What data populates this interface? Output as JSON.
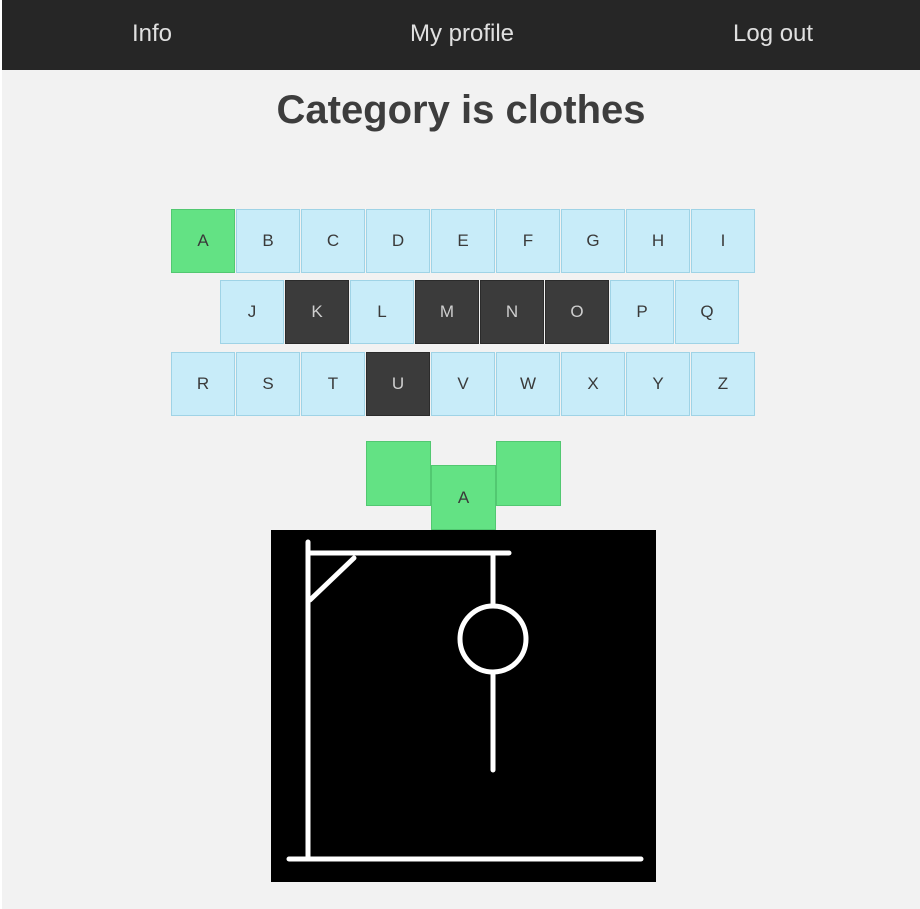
{
  "nav": {
    "info": "Info",
    "profile": "My profile",
    "logout": "Log out"
  },
  "title": "Category is clothes",
  "keyboard": {
    "row1": [
      {
        "letter": "A",
        "state": "correct"
      },
      {
        "letter": "B",
        "state": "unused"
      },
      {
        "letter": "C",
        "state": "unused"
      },
      {
        "letter": "D",
        "state": "unused"
      },
      {
        "letter": "E",
        "state": "unused"
      },
      {
        "letter": "F",
        "state": "unused"
      },
      {
        "letter": "G",
        "state": "unused"
      },
      {
        "letter": "H",
        "state": "unused"
      },
      {
        "letter": "I",
        "state": "unused"
      }
    ],
    "row2": [
      {
        "letter": "J",
        "state": "unused"
      },
      {
        "letter": "K",
        "state": "wrong"
      },
      {
        "letter": "L",
        "state": "unused"
      },
      {
        "letter": "M",
        "state": "wrong"
      },
      {
        "letter": "N",
        "state": "wrong"
      },
      {
        "letter": "O",
        "state": "wrong"
      },
      {
        "letter": "P",
        "state": "unused"
      },
      {
        "letter": "Q",
        "state": "unused"
      }
    ],
    "row3": [
      {
        "letter": "R",
        "state": "unused"
      },
      {
        "letter": "S",
        "state": "unused"
      },
      {
        "letter": "T",
        "state": "unused"
      },
      {
        "letter": "U",
        "state": "wrong"
      },
      {
        "letter": "V",
        "state": "unused"
      },
      {
        "letter": "W",
        "state": "unused"
      },
      {
        "letter": "X",
        "state": "unused"
      },
      {
        "letter": "Y",
        "state": "unused"
      },
      {
        "letter": "Z",
        "state": "unused"
      }
    ]
  },
  "word_slots": [
    "",
    "A",
    ""
  ],
  "hangman_parts": [
    "base",
    "pole",
    "beam",
    "brace",
    "rope",
    "head",
    "body"
  ],
  "colors": {
    "navbar": "#262626",
    "background": "#f2f2f2",
    "key_unused": "#c8ecf9",
    "key_correct": "#63e284",
    "key_wrong": "#3b3b3b",
    "gallows_bg": "#000000",
    "gallows_stroke": "#ffffff"
  }
}
